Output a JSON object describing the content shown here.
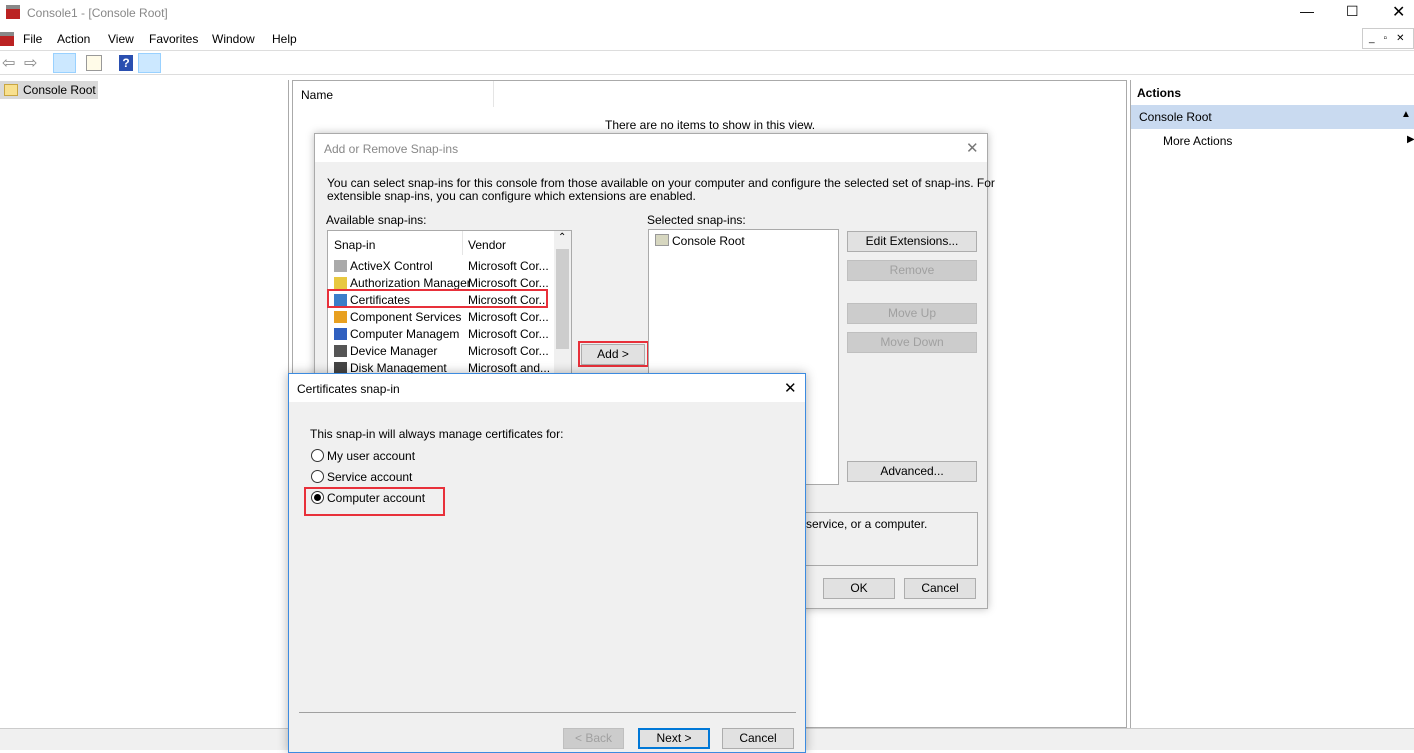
{
  "window": {
    "title": "Console1 - [Console Root]",
    "controls": [
      "minimize",
      "maximize",
      "close"
    ]
  },
  "menu": [
    "File",
    "Action",
    "View",
    "Favorites",
    "Window",
    "Help"
  ],
  "toolbar": [
    "back-icon",
    "forward-icon",
    "show-hide-tree-icon",
    "export-list-icon",
    "help-icon",
    "show-hide-action-pane-icon"
  ],
  "tree": {
    "root": "Console Root"
  },
  "center": {
    "column": "Name",
    "empty": "There are no items to show in this view."
  },
  "actions": {
    "header": "Actions",
    "section": "Console Root",
    "item": "More Actions"
  },
  "snapins_dialog": {
    "title": "Add or Remove Snap-ins",
    "desc1": "You can select snap-ins for this console from those available on your computer and configure the selected set of snap-ins. For",
    "desc2": "extensible snap-ins, you can configure which extensions are enabled.",
    "available_label": "Available snap-ins:",
    "selected_label": "Selected snap-ins:",
    "columns": [
      "Snap-in",
      "Vendor"
    ],
    "rows": [
      {
        "name": "ActiveX Control",
        "vendor": "Microsoft Cor..."
      },
      {
        "name": "Authorization Manager",
        "vendor": "Microsoft Cor..."
      },
      {
        "name": "Certificates",
        "vendor": "Microsoft Cor..."
      },
      {
        "name": "Component Services",
        "vendor": "Microsoft Cor..."
      },
      {
        "name": "Computer Managem",
        "vendor": "Microsoft Cor..."
      },
      {
        "name": "Device Manager",
        "vendor": "Microsoft Cor..."
      },
      {
        "name": "Disk Management",
        "vendor": "Microsoft and..."
      }
    ],
    "selected": [
      "Console Root"
    ],
    "add": "Add >",
    "edit_extensions": "Edit Extensions...",
    "remove": "Remove",
    "move_up": "Move Up",
    "move_down": "Move Down",
    "advanced": "Advanced...",
    "description": "service, or a computer.",
    "ok": "OK",
    "cancel": "Cancel"
  },
  "cert_dialog": {
    "title": "Certificates snap-in",
    "prompt": "This snap-in will always manage certificates for:",
    "options": [
      "My user account",
      "Service account",
      "Computer account"
    ],
    "selected_option": "Computer account",
    "back": "< Back",
    "next": "Next >",
    "cancel": "Cancel"
  },
  "colors": {
    "highlight": "#e8303a",
    "accent": "#0078d7",
    "actions_section": "#c9daf0"
  }
}
